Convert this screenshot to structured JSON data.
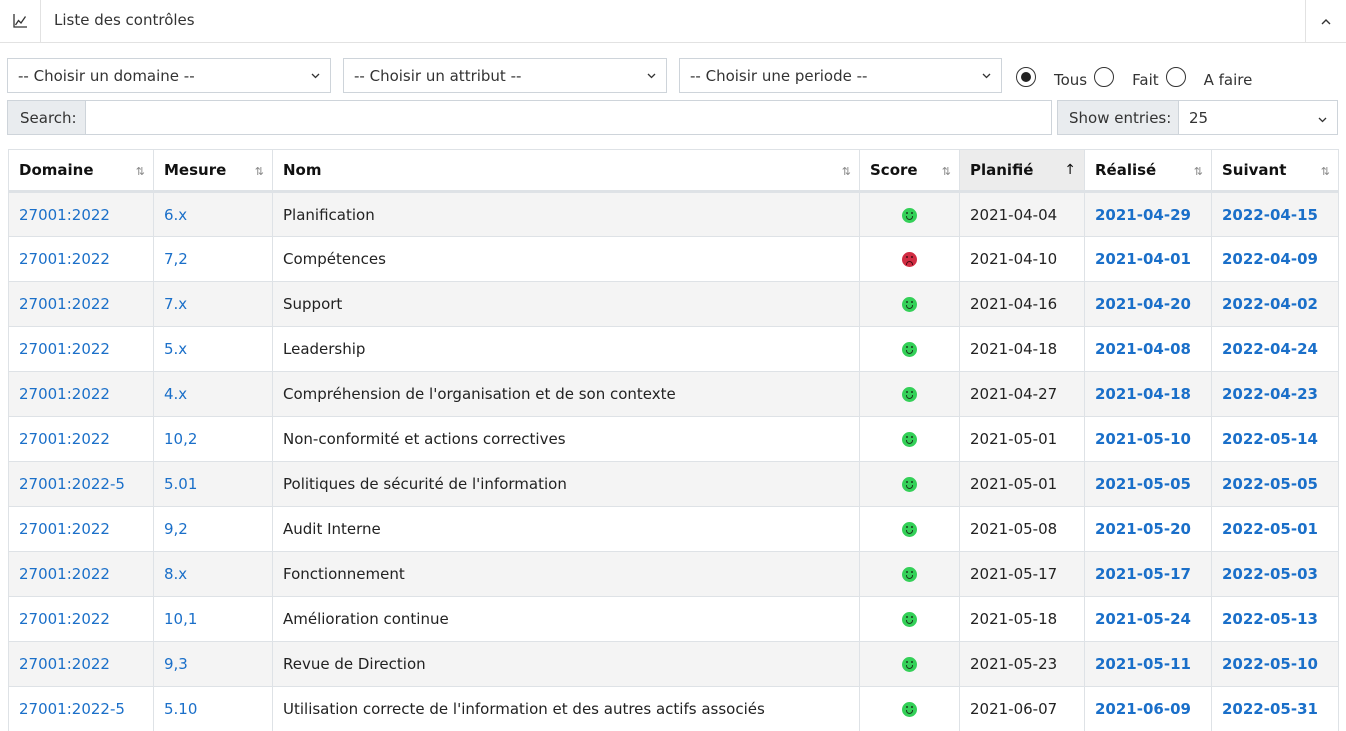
{
  "panel": {
    "title": "Liste des contrôles",
    "icon": "chart-line-icon",
    "collapse_icon": "chevron-up-icon"
  },
  "filters": {
    "domain_select": "-- Choisir un domaine --",
    "attribute_select": "-- Choisir un attribut --",
    "period_select": "-- Choisir une periode --",
    "radios": [
      {
        "label": "Tous",
        "checked": true
      },
      {
        "label": "Fait",
        "checked": false
      },
      {
        "label": "A faire",
        "checked": false
      }
    ]
  },
  "search": {
    "label": "Search:",
    "value": ""
  },
  "entries": {
    "label": "Show entries:",
    "value": "25"
  },
  "table": {
    "columns": [
      "Domaine",
      "Mesure",
      "Nom",
      "Score",
      "Planifié",
      "Réalisé",
      "Suivant"
    ],
    "sorted_column": "Planifié",
    "sort_icon": "↑",
    "unsorted_icon": "⇅",
    "rows": [
      {
        "domaine": "27001:2022",
        "mesure": "6.x",
        "nom": "Planification",
        "score": "good",
        "planifie": "2021-04-04",
        "realise": "2021-04-29",
        "suivant": "2022-04-15"
      },
      {
        "domaine": "27001:2022",
        "mesure": "7,2",
        "nom": "Compétences",
        "score": "bad",
        "planifie": "2021-04-10",
        "realise": "2021-04-01",
        "suivant": "2022-04-09"
      },
      {
        "domaine": "27001:2022",
        "mesure": "7.x",
        "nom": "Support",
        "score": "good",
        "planifie": "2021-04-16",
        "realise": "2021-04-20",
        "suivant": "2022-04-02"
      },
      {
        "domaine": "27001:2022",
        "mesure": "5.x",
        "nom": "Leadership",
        "score": "good",
        "planifie": "2021-04-18",
        "realise": "2021-04-08",
        "suivant": "2022-04-24"
      },
      {
        "domaine": "27001:2022",
        "mesure": "4.x",
        "nom": "Compréhension de l'organisation et de son contexte",
        "score": "good",
        "planifie": "2021-04-27",
        "realise": "2021-04-18",
        "suivant": "2022-04-23"
      },
      {
        "domaine": "27001:2022",
        "mesure": "10,2",
        "nom": "Non-conformité et actions correctives",
        "score": "good",
        "planifie": "2021-05-01",
        "realise": "2021-05-10",
        "suivant": "2022-05-14"
      },
      {
        "domaine": "27001:2022-5",
        "mesure": "5.01",
        "nom": "Politiques de sécurité de l'information",
        "score": "good",
        "planifie": "2021-05-01",
        "realise": "2021-05-05",
        "suivant": "2022-05-05"
      },
      {
        "domaine": "27001:2022",
        "mesure": "9,2",
        "nom": "Audit Interne",
        "score": "good",
        "planifie": "2021-05-08",
        "realise": "2021-05-20",
        "suivant": "2022-05-01"
      },
      {
        "domaine": "27001:2022",
        "mesure": "8.x",
        "nom": "Fonctionnement",
        "score": "good",
        "planifie": "2021-05-17",
        "realise": "2021-05-17",
        "suivant": "2022-05-03"
      },
      {
        "domaine": "27001:2022",
        "mesure": "10,1",
        "nom": "Amélioration continue",
        "score": "good",
        "planifie": "2021-05-18",
        "realise": "2021-05-24",
        "suivant": "2022-05-13"
      },
      {
        "domaine": "27001:2022",
        "mesure": "9,3",
        "nom": "Revue de Direction",
        "score": "good",
        "planifie": "2021-05-23",
        "realise": "2021-05-11",
        "suivant": "2022-05-10"
      },
      {
        "domaine": "27001:2022-5",
        "mesure": "5.10",
        "nom": "Utilisation correcte de l'information et des autres actifs associés",
        "score": "good",
        "planifie": "2021-06-07",
        "realise": "2021-06-09",
        "suivant": "2022-05-31"
      }
    ]
  },
  "colors": {
    "link": "#1a6fc9",
    "score_good": "#34d058",
    "score_bad": "#d12d43"
  }
}
